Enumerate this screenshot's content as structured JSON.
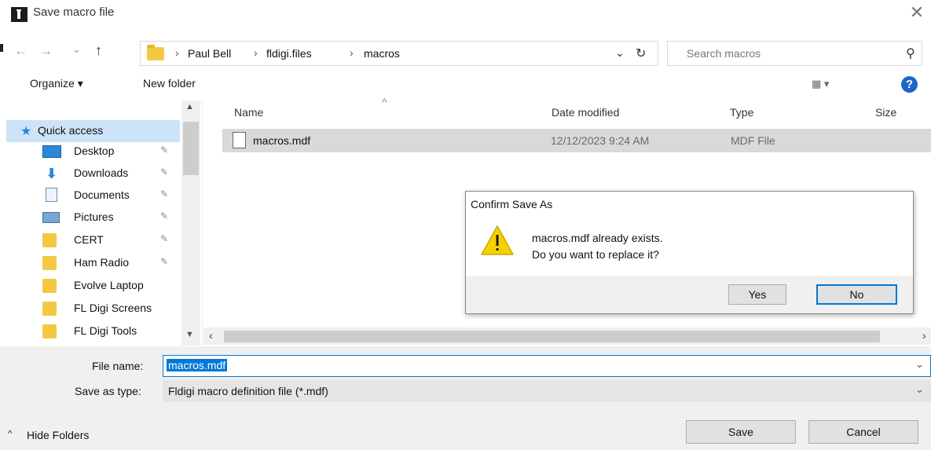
{
  "window": {
    "title": "Save macro file",
    "close_glyph": "✕"
  },
  "nav": {
    "back_glyph": "←",
    "forward_glyph": "→",
    "recent_glyph": "⌄",
    "up_glyph": "↑",
    "breadcrumbs": [
      "Paul Bell",
      "fldigi.files",
      "macros"
    ],
    "crumb_sep": "›",
    "dropdown_glyph": "⌄",
    "refresh_glyph": "↻"
  },
  "search": {
    "placeholder": "Search macros",
    "icon": "search-icon",
    "glyph": "⚲"
  },
  "toolbar": {
    "organize_label": "Organize ▾",
    "new_folder_label": "New folder",
    "view_label": "▦ ▾",
    "help_label": "?"
  },
  "sidebar": {
    "quick_access": "Quick access",
    "items": [
      {
        "label": "Desktop",
        "icon": "desktop-icon",
        "pinned": true
      },
      {
        "label": "Downloads",
        "icon": "downloads-icon",
        "pinned": true
      },
      {
        "label": "Documents",
        "icon": "documents-icon",
        "pinned": true
      },
      {
        "label": "Pictures",
        "icon": "pictures-icon",
        "pinned": true
      },
      {
        "label": "CERT",
        "icon": "folder-icon",
        "pinned": true
      },
      {
        "label": "Ham Radio",
        "icon": "folder-icon",
        "pinned": true
      },
      {
        "label": "Evolve Laptop",
        "icon": "folder-icon",
        "pinned": false
      },
      {
        "label": "FL Digi Screens",
        "icon": "folder-icon",
        "pinned": false
      },
      {
        "label": "FL Digi Tools",
        "icon": "folder-icon",
        "pinned": false
      }
    ],
    "pin_glyph": "✎"
  },
  "file_list": {
    "columns": [
      "Name",
      "Date modified",
      "Type",
      "Size"
    ],
    "sort_glyph": "^",
    "rows": [
      {
        "name": "macros.mdf",
        "date": "12/12/2023 9:24 AM",
        "type": "MDF File",
        "size": ""
      }
    ]
  },
  "footer": {
    "file_name_label": "File name:",
    "file_name_value": "macros.mdf",
    "save_type_label": "Save as type:",
    "save_type_value": "Fldigi macro definition file (*.mdf)",
    "hide_folders": "Hide Folders",
    "save_label": "Save",
    "cancel_label": "Cancel",
    "chevron_glyph": "⌄"
  },
  "confirm_dialog": {
    "title": "Confirm Save As",
    "line1": "macros.mdf already exists.",
    "line2": "Do you want to replace it?",
    "yes_label": "Yes",
    "no_label": "No"
  },
  "colors": {
    "accent": "#0078d7",
    "selection": "#cde3f7",
    "folder": "#f5c842",
    "warning": "#f7d000"
  }
}
